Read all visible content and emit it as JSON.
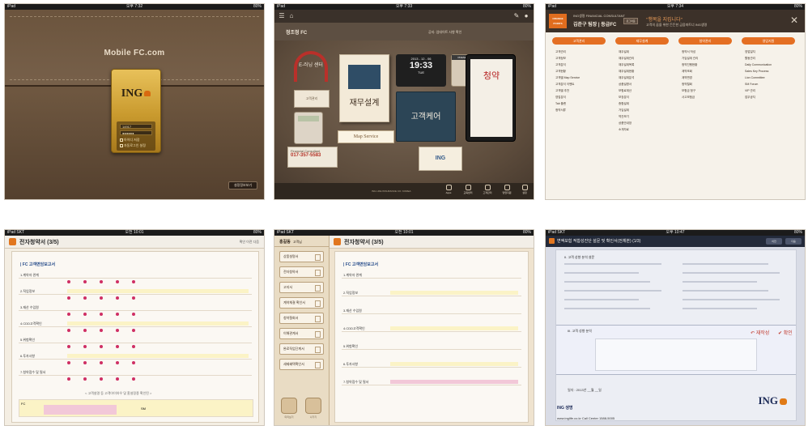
{
  "screens": {
    "login": {
      "status": {
        "left": "iPad",
        "center": "오후 7:32",
        "right": "80%"
      },
      "site_title": "Mobile FC.com",
      "brand": "ING",
      "id_value": "14917",
      "password_mask": "●●●●●●",
      "remember_label": "아이디 저장",
      "auto_label": "자동로그인 설정",
      "corner_button": "설정정보보기"
    },
    "desk": {
      "status": {
        "left": "iPad",
        "center": "오후 7:33",
        "right": "80%"
      },
      "user_name": "정조정 FC",
      "user_note": "공지: 업데이트 사항 확인",
      "headphone_label": "E-러닝 센터",
      "calendar_label": "고객관리",
      "notebook_label": "재무설계",
      "map_service": "Map Service",
      "date_text": "2013 - 12 - 06",
      "time_text": "19:33",
      "day_text": "TUE",
      "widget_label": "PRESENTATION",
      "folder_label": "고객케어",
      "ereader_label": "청약",
      "card_title": "Financial Consultant",
      "card_number": "017-357-5583",
      "paper_label": "ING",
      "dock_items": [
        "Apps",
        "교육센터",
        "고객관리",
        "영업지원",
        "설정"
      ],
      "copyright": "ING LIFE INSURANCE CO. KOREA"
    },
    "menu": {
      "status": {
        "left": "iPad",
        "center": "오후 7:34",
        "right": "80%"
      },
      "orange_badge": "ORANGE POINTS",
      "company_line": "ING생명 FINANCIAL CONSULTANT",
      "consultant": "김준구 팀장 | 등급FC",
      "header_button": "로그아웃",
      "slogan": "\"행복을 지킵니다\"",
      "subline": "고객의 꿈을 위한 든든한 금융파트너 ING생명",
      "close_glyph": "✕",
      "columns": [
        {
          "title": "고객관리",
          "items": [
            "고객관리",
            "고객정보",
            "고객분석",
            "고객현황",
            "고객별 Map Service",
            "고객분석 이벤트",
            "고객별 추천",
            "영업분석",
            "Tab 플랜",
            "청약서류"
          ]
        },
        {
          "title": "재무설계",
          "items": [
            "재무설계",
            "재무설계관리",
            "재무설계목록",
            "재무설계현황",
            "재무설계분석",
            "상품설명서",
            "보험료계산",
            "보장분석",
            "종합설계",
            "가입설계",
            "약관보기",
            "상품안내장",
            "소개자료"
          ]
        },
        {
          "title": "청약관리",
          "items": [
            "청약서 작성",
            "가입설계 관리",
            "청약진행현황",
            "계약조회",
            "계약변경",
            "청약철회",
            "보험금 청구",
            "사고보험금"
          ]
        },
        {
          "title": "영업지원",
          "items": [
            "영업일지",
            "활동관리",
            "Daily Communication",
            "Sales Key Process",
            "Lion Committee",
            "SM Forum",
            "VIP 관리",
            "업무공지"
          ]
        }
      ]
    },
    "form_a": {
      "status": {
        "left": "iPad SKT",
        "center": "오전 10:01",
        "right": "80%"
      },
      "title": "전자청약서 (3/5)",
      "tools": "확인  이전  다음",
      "section": "| FC 고객면담보고서",
      "rows": [
        "1.계약자 관계",
        "2.직업정보",
        "3.재산 수입원",
        "4.CDD고객확인",
        "5.위험확인",
        "6.투자사항",
        "7.청약점수 및 필서"
      ],
      "footnote": "< 고객설명 등 고객아이하우 및 홈설정종 확인된 >",
      "table_headers": [
        "FC",
        "필명",
        "코드",
        "성명",
        "사인",
        "SM"
      ]
    },
    "form_b": {
      "status": {
        "left": "iPad SKT",
        "center": "오전 10:01",
        "right": "80%"
      },
      "user": "홍길동",
      "user_role": "고객님",
      "title": "전자청약서 (3/5)",
      "side_buttons": [
        "상품설명서",
        "전자청약서",
        "고지서",
        "계약체결 확인서",
        "청약철회서",
        "이해관계서",
        "완료직업단계서",
        "세제혜택확인서"
      ],
      "foot_items": [
        "미리보기",
        "나가기"
      ],
      "section": "| FC 고객면담보고서"
    },
    "confirm": {
      "status": {
        "left": "iPad SKT",
        "center": "오후 10:47",
        "right": "80%"
      },
      "title": "변액보험 적합성진단 설문 및 확인서(전체본) (1/3)",
      "buttons": [
        "이전",
        "다음"
      ],
      "section_two": "II. 고객 성향 분석 설문",
      "section_three": "III. 고객 성향 분석",
      "rewrite": "↶ 재작성",
      "check": "✔ 확인",
      "date_label": "일자 : 2013년 __월 __일",
      "brand": "ING",
      "brand_line": "ING 생명",
      "contact": "www.inglife.co.kr   Call Center 1588-5005"
    }
  }
}
